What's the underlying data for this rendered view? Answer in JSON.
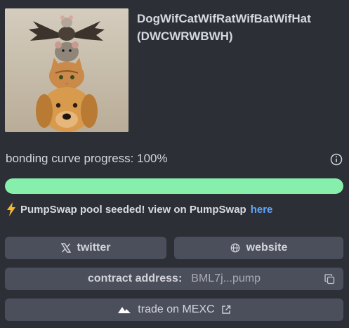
{
  "token": {
    "name_line": "DogWifCatWifRatWifBatWifHat",
    "ticker_line": "(DWCWRWBWH)",
    "image_name": "token-image"
  },
  "progress": {
    "label": "bonding curve progress: 100%",
    "value": 1.0,
    "fill_color": "#86efac"
  },
  "pool": {
    "text": "PumpSwap pool seeded! view on PumpSwap",
    "link_label": "here",
    "link_color": "#60a5fa",
    "icon": "lightning-bolt-icon"
  },
  "links": {
    "twitter_label": "twitter",
    "twitter_icon": "x-logo-icon",
    "website_label": "website",
    "website_icon": "globe-icon"
  },
  "contract": {
    "label": "contract address:",
    "value": "BML7j...pump",
    "icon": "copy-icon"
  },
  "exchange": {
    "label": "trade on MEXC",
    "logo_icon": "mexc-logo-icon",
    "external_icon": "external-link-icon"
  }
}
